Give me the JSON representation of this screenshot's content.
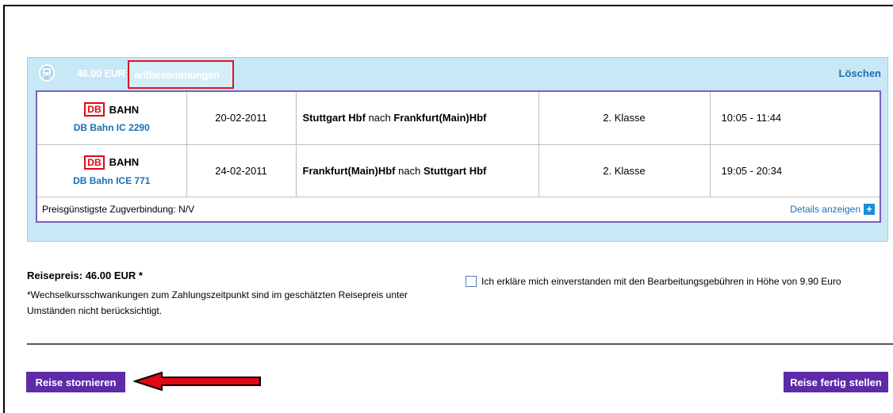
{
  "panel": {
    "price": "46.00 EUR",
    "tariff_link": "arifbestimmungen",
    "delete_link": "Löschen"
  },
  "trips": [
    {
      "carrier_logo": "DB",
      "carrier_text": "BAHN",
      "train": "DB Bahn  IC 2290",
      "date": "20-02-2011",
      "from": "Stuttgart Hbf",
      "connector": "nach",
      "to": "Frankfurt(Main)Hbf",
      "class": "2. Klasse",
      "time": "10:05 - 11:44"
    },
    {
      "carrier_logo": "DB",
      "carrier_text": "BAHN",
      "train": "DB Bahn  ICE 771",
      "date": "24-02-2011",
      "from": "Frankfurt(Main)Hbf",
      "connector": "nach",
      "to": "Stuttgart Hbf",
      "class": "2. Klasse",
      "time": "19:05 - 20:34"
    }
  ],
  "cheapest": {
    "label": "Preisgünstigste Zugverbindung:",
    "value": "N/V",
    "details_link": "Details anzeigen"
  },
  "summary": {
    "travel_price": "Reisepreis: 46.00 EUR *",
    "fx_note": "*Wechselkursschwankungen zum Zahlungszeitpunkt sind im geschätzten Reisepreis unter Umständen nicht berücksichtigt.",
    "agree_text": "Ich erkläre mich einverstanden mit den Bearbeitungsgebühren in Höhe von 9.90 Euro"
  },
  "actions": {
    "cancel": "Reise stornieren",
    "finish": "Reise fertig stellen"
  },
  "colors": {
    "panel_bg": "#c9e8f5",
    "button_bg": "#5e2aa8",
    "link": "#1a6fb5",
    "highlight": "#e0141e"
  }
}
